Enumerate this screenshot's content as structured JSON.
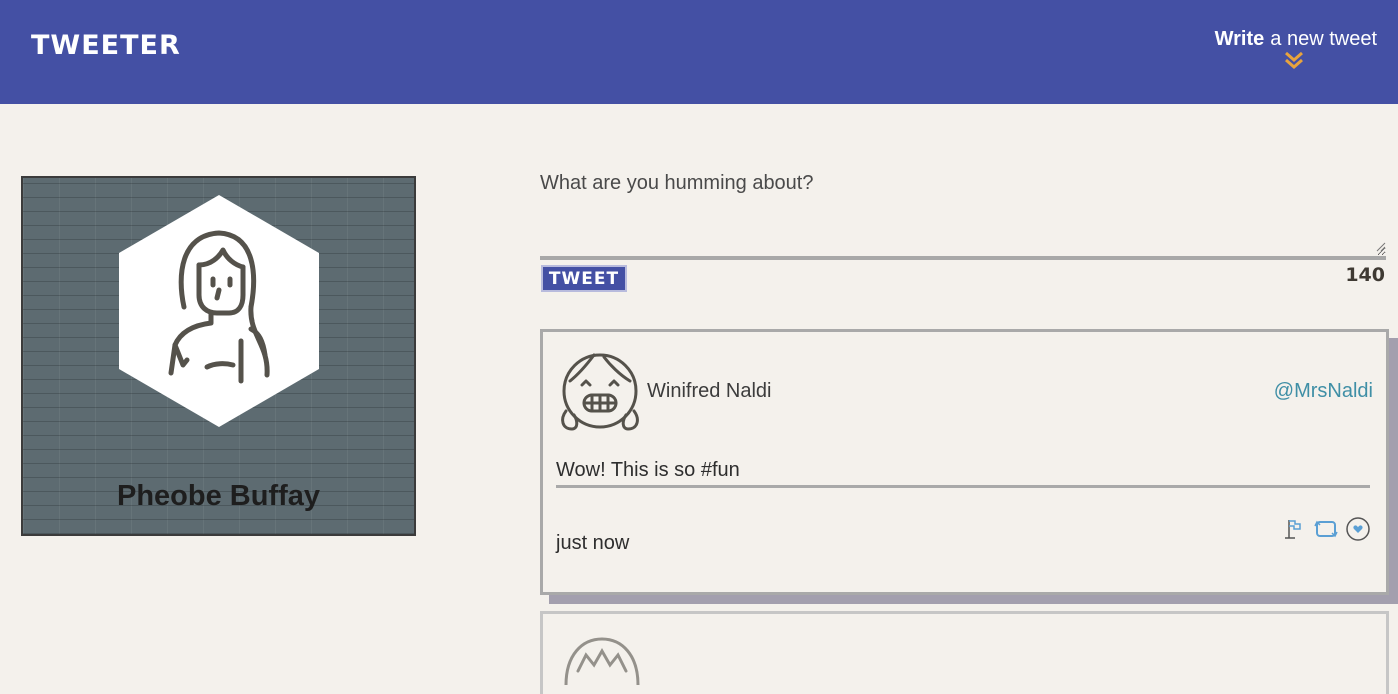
{
  "nav": {
    "brand": "TWEETER",
    "compose_bold": "Write",
    "compose_rest": "a new tweet"
  },
  "profile": {
    "name": "Pheobe Buffay",
    "avatar_icon": "woman-long-hair-avatar-icon"
  },
  "compose": {
    "placeholder": "What are you humming about?",
    "button_label": "TWEET",
    "counter": "140"
  },
  "tweets": [
    {
      "author": "Winifred Naldi",
      "handle": "@MrsNaldi",
      "content": "Wow! This is so #fun",
      "time": "just now",
      "avatar_icon": "smiling-girl-avatar-icon",
      "actions": [
        "flag-icon",
        "retweet-icon",
        "heart-icon"
      ]
    }
  ],
  "colors": {
    "nav": "#4450a4",
    "background": "#f4f1ec",
    "accent": "#e8a33d",
    "handle": "#3f8fa6"
  }
}
